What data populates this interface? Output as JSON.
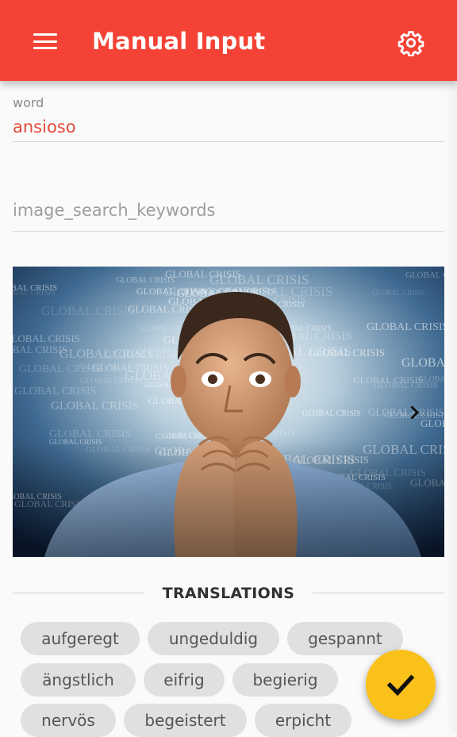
{
  "app_bar": {
    "title": "Manual Input",
    "menu_icon": "menu-icon",
    "settings_icon": "gear-icon",
    "color": "#f44336"
  },
  "form": {
    "word": {
      "label": "word",
      "value": "ansioso"
    },
    "image_search_keywords": {
      "placeholder": "image_search_keywords",
      "value": ""
    }
  },
  "image_panel": {
    "background_words": "GLOBAL CRISIS",
    "next_icon": "chevron-right-icon"
  },
  "translations": {
    "heading": "TRANSLATIONS",
    "chips": [
      "aufgeregt",
      "ungeduldig",
      "gespannt",
      "ängstlich",
      "eifrig",
      "begierig",
      "nervös",
      "begeistert",
      "erpicht"
    ]
  },
  "fab": {
    "icon": "check-icon",
    "color": "#fbc11b"
  },
  "colors": {
    "accent": "#e5493a",
    "chip_bg": "#e0e0e0"
  }
}
